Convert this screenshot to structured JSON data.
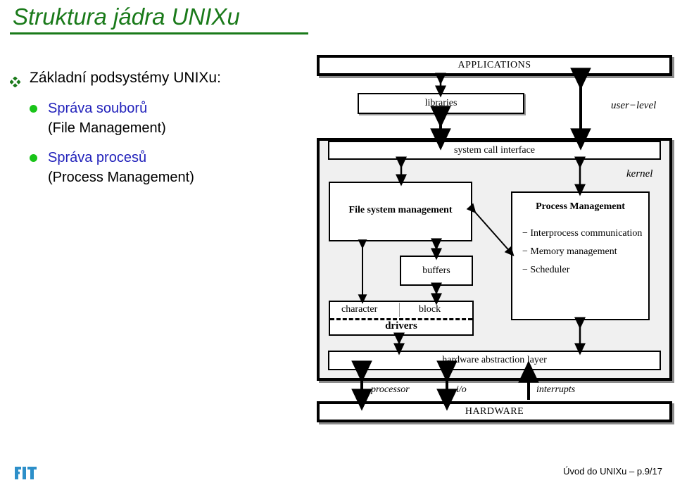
{
  "slide": {
    "title": "Struktura jádra UNIXu",
    "title_color": "#1a7a1a"
  },
  "bullets": {
    "level1": "Základní podsystémy UNIXu:",
    "items": [
      {
        "main": "Správa souborů",
        "sub": "(File Management)"
      },
      {
        "main": "Správa procesů",
        "sub": "(Process Management)"
      }
    ],
    "main_color": "#2222bb",
    "dot_color": "#19c419",
    "diamond_color": "#1a7a1a"
  },
  "diagram": {
    "applications": "APPLICATIONS",
    "libraries": "libraries",
    "system_call_interface": "system call interface",
    "user_level_label": "user−level",
    "kernel_label": "kernel",
    "file_system_management": "File system management",
    "buffers": "buffers",
    "process_management": {
      "title": "Process Management",
      "items": [
        "− Interprocess communication",
        "− Memory management",
        "− Scheduler"
      ]
    },
    "drivers": {
      "character": "character",
      "block": "block",
      "label": "drivers"
    },
    "hardware_abstraction_layer": "hardware abstraction layer",
    "bus_labels": {
      "processor": "processor",
      "io": "i/o",
      "interrupts": "interrupts"
    },
    "hardware": "HARDWARE",
    "kernel_bg": "#f0f0f0"
  },
  "footer": {
    "text": "Úvod do UNIXu – p.9/17",
    "logo": "fit-logo",
    "logo_color": "#2d8fc9"
  }
}
